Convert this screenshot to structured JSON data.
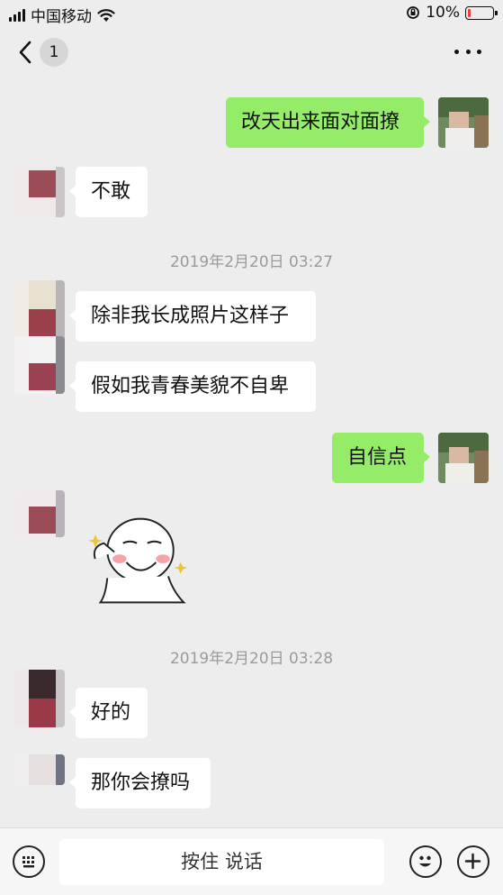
{
  "status_bar": {
    "carrier": "中国移动",
    "battery_percent": "10%",
    "battery_level": 0.1
  },
  "nav": {
    "back_badge": "1"
  },
  "messages": [
    {
      "side": "me",
      "text": "改天出来面对面撩"
    },
    {
      "side": "other",
      "text": "不敢"
    },
    {
      "side": "other",
      "text": "除非我长成照片这样子"
    },
    {
      "side": "other",
      "text": "假如我青春美貌不自卑"
    },
    {
      "side": "me",
      "text": "自信点"
    },
    {
      "side": "other",
      "text": "好的"
    },
    {
      "side": "other",
      "text": "那你会撩吗"
    }
  ],
  "timestamps": [
    "2019年2月20日 03:27",
    "2019年2月20日 03:28"
  ],
  "bottom_bar": {
    "voice_label": "按住 说话"
  },
  "colors": {
    "background": "#ededed",
    "my_bubble": "#95ec69",
    "other_bubble": "#ffffff",
    "timestamp_text": "#9a9a9a",
    "battery_low": "#e64340"
  }
}
